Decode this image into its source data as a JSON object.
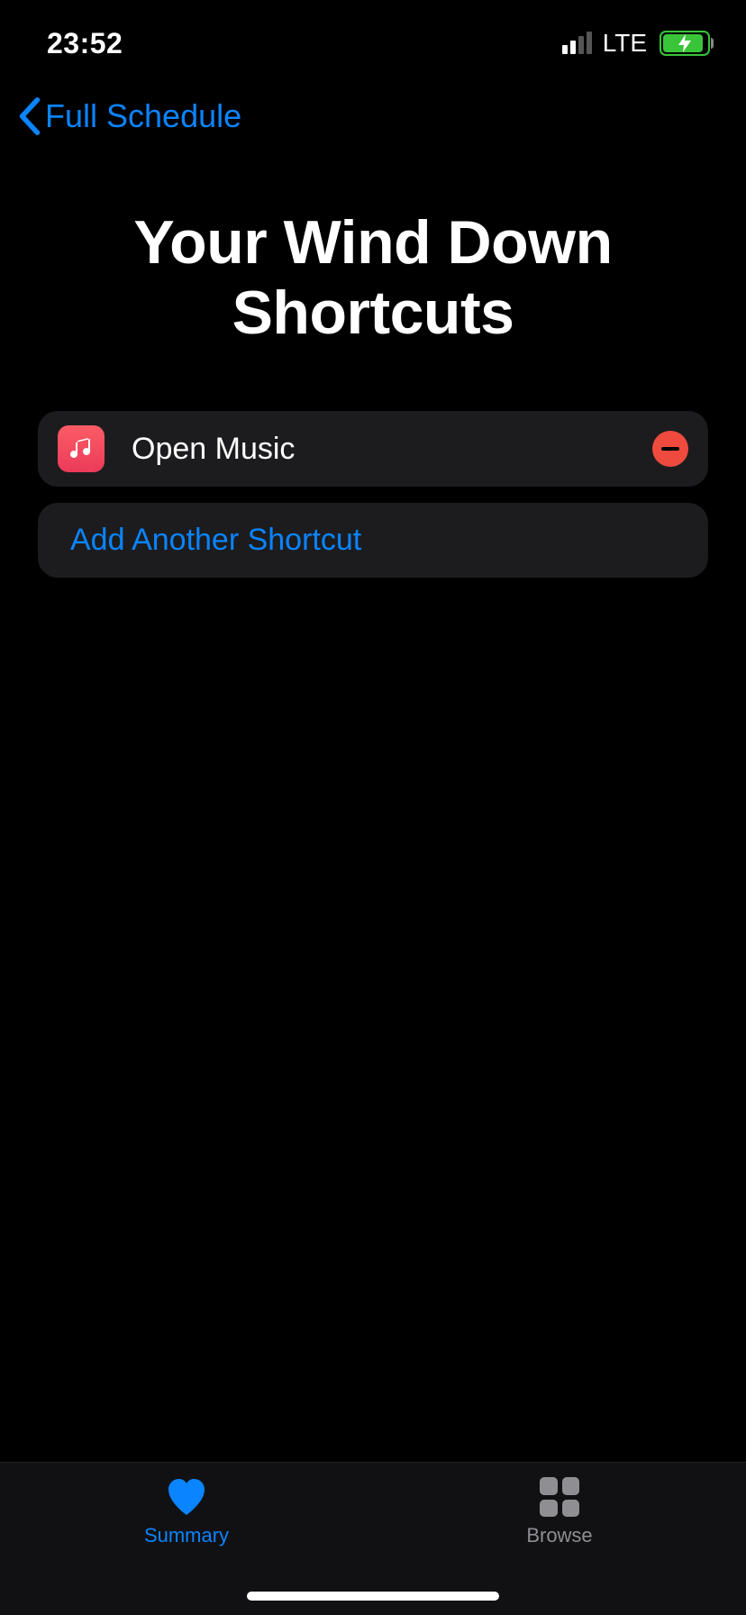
{
  "status_bar": {
    "time": "23:52",
    "network": "LTE"
  },
  "nav": {
    "back_label": "Full Schedule"
  },
  "main": {
    "title": "Your Wind Down Shortcuts",
    "shortcuts": [
      {
        "label": "Open Music",
        "icon": "music-app-icon"
      }
    ],
    "add_label": "Add Another Shortcut"
  },
  "tabs": {
    "summary": "Summary",
    "browse": "Browse"
  }
}
